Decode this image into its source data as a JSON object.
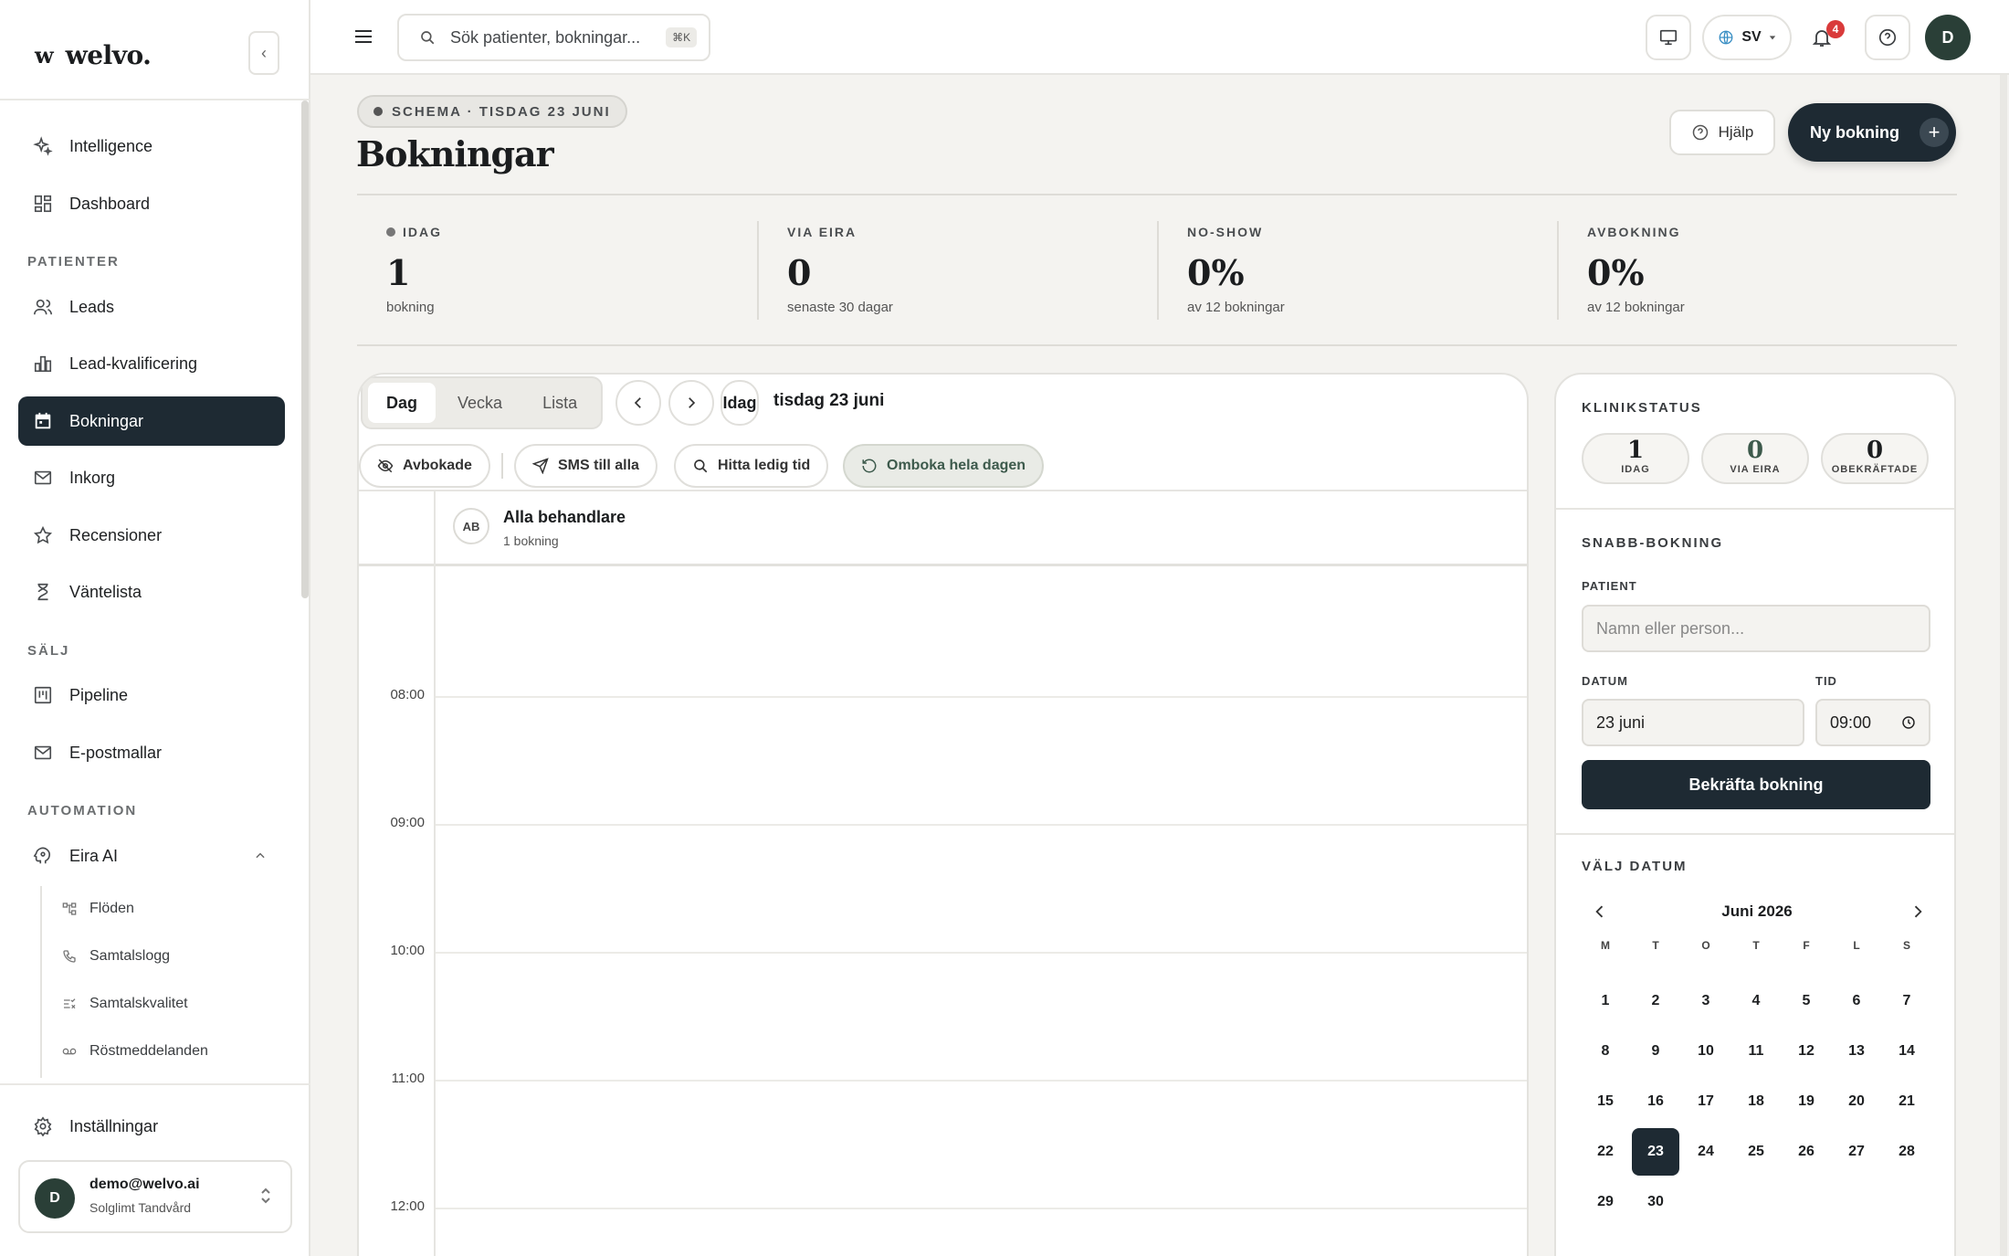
{
  "app": {
    "logo_mark": "w",
    "logo_text": "welvo.",
    "collapse_glyph": "‹"
  },
  "sidebar": {
    "top_items": [
      {
        "label": "Intelligence",
        "icon": "sparkles-icon"
      },
      {
        "label": "Dashboard",
        "icon": "dashboard-icon"
      }
    ],
    "sections": [
      {
        "title": "PATIENTER",
        "items": [
          {
            "label": "Leads",
            "icon": "users-icon"
          },
          {
            "label": "Lead-kvalificering",
            "icon": "bar-chart-icon"
          },
          {
            "label": "Bokningar",
            "icon": "calendar-icon",
            "active": true
          },
          {
            "label": "Inkorg",
            "icon": "mail-icon"
          },
          {
            "label": "Recensioner",
            "icon": "star-icon"
          },
          {
            "label": "Väntelista",
            "icon": "hourglass-icon"
          }
        ]
      },
      {
        "title": "SÄLJ",
        "items": [
          {
            "label": "Pipeline",
            "icon": "kanban-icon"
          },
          {
            "label": "E-postmallar",
            "icon": "mail-icon"
          }
        ]
      },
      {
        "title": "AUTOMATION",
        "items": [
          {
            "label": "Eira AI",
            "icon": "brain-icon",
            "expanded": true
          }
        ]
      }
    ],
    "sub_items": [
      {
        "label": "Flöden",
        "icon": "flow-icon"
      },
      {
        "label": "Samtalslogg",
        "icon": "phone-icon"
      },
      {
        "label": "Samtalskvalitet",
        "icon": "quality-icon"
      },
      {
        "label": "Röstmeddelanden",
        "icon": "voicemail-icon"
      }
    ],
    "settings_label": "Inställningar",
    "user": {
      "initial": "D",
      "email": "demo@welvo.ai",
      "clinic": "Solglimt Tandvård"
    }
  },
  "topbar": {
    "search_placeholder": "Sök patienter, bokningar...",
    "search_shortcut": "⌘K",
    "language": "SV",
    "notification_count": "4",
    "avatar_initial": "D"
  },
  "page": {
    "breadcrumb": "SCHEMA · TISDAG 23 JUNI",
    "title": "Bokningar",
    "help_label": "Hjälp",
    "new_booking_label": "Ny bokning"
  },
  "stats": [
    {
      "label": "IDAG",
      "value": "1",
      "sub": "bokning",
      "dot": true
    },
    {
      "label": "VIA EIRA",
      "value": "0",
      "sub": "senaste 30 dagar"
    },
    {
      "label": "NO-SHOW",
      "value": "0%",
      "sub": "av 12 bokningar"
    },
    {
      "label": "AVBOKNING",
      "value": "0%",
      "sub": "av 12 bokningar"
    }
  ],
  "calendar": {
    "view_tabs": [
      "Dag",
      "Vecka",
      "Lista"
    ],
    "active_view": "Dag",
    "today_label": "Idag",
    "date_label": "tisdag 23 juni",
    "filters": [
      {
        "label": "Avbokade",
        "icon": "eye-off-icon"
      },
      {
        "label": "SMS till alla",
        "icon": "send-icon"
      },
      {
        "label": "Hitta ledig tid",
        "icon": "search-icon"
      },
      {
        "label": "Omboka hela dagen",
        "icon": "refresh-icon",
        "accent": true
      }
    ],
    "resource": {
      "initials": "AB",
      "name": "Alla behandlare",
      "sub": "1 bokning"
    },
    "hours": [
      "08:00",
      "09:00",
      "10:00",
      "11:00",
      "12:00"
    ]
  },
  "right_panel": {
    "clinic_status_title": "KLINIKSTATUS",
    "clinic_status": [
      {
        "value": "1",
        "label": "IDAG"
      },
      {
        "value": "0",
        "label": "VIA EIRA",
        "accent": true
      },
      {
        "value": "0",
        "label": "OBEKRÄFTADE"
      }
    ],
    "quick_title": "SNABB-BOKNING",
    "patient_label": "PATIENT",
    "patient_placeholder": "Namn eller person...",
    "date_label": "DATUM",
    "date_value": "23 juni",
    "time_label": "TID",
    "time_value": "09:00",
    "confirm_label": "Bekräfta bokning",
    "pick_date_title": "VÄLJ DATUM",
    "month_title": "Juni 2026",
    "weekdays": [
      "M",
      "T",
      "O",
      "T",
      "F",
      "L",
      "S"
    ],
    "days": [
      "1",
      "2",
      "3",
      "4",
      "5",
      "6",
      "7",
      "8",
      "9",
      "10",
      "11",
      "12",
      "13",
      "14",
      "15",
      "16",
      "17",
      "18",
      "19",
      "20",
      "21",
      "22",
      "23",
      "24",
      "25",
      "26",
      "27",
      "28",
      "29",
      "30"
    ],
    "selected_day": "23"
  },
  "colors": {
    "primary_dark": "#1e2a33",
    "avatar_green": "#2a3f37",
    "badge_red": "#d93a3a",
    "accent_green": "#3d5a4c"
  }
}
